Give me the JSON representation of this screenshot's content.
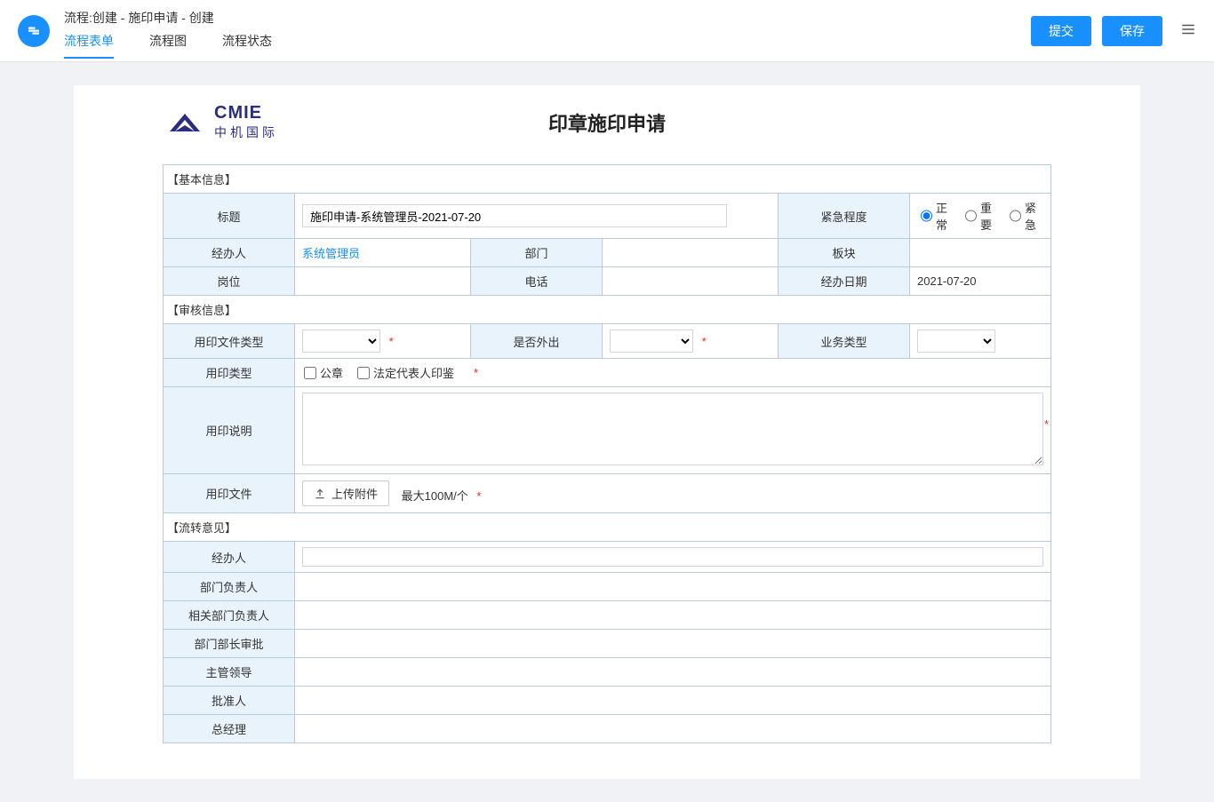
{
  "header": {
    "breadcrumb": "流程:创建 - 施印申请 - 创建",
    "tabs": {
      "form": "流程表单",
      "diagram": "流程图",
      "status": "流程状态"
    },
    "actions": {
      "submit": "提交",
      "save": "保存"
    }
  },
  "logo": {
    "en": "CMIE",
    "cn": "中机国际"
  },
  "form_title": "印章施印申请",
  "sections": {
    "basic": "【基本信息】",
    "audit": "【审核信息】",
    "flow": "【流转意见】"
  },
  "labels": {
    "title": "标题",
    "urgency": "紧急程度",
    "handler": "经办人",
    "department": "部门",
    "block": "板块",
    "position": "岗位",
    "phone": "电话",
    "handle_date": "经办日期",
    "file_type": "用印文件类型",
    "is_out": "是否外出",
    "biz_type": "业务类型",
    "seal_type": "用印类型",
    "seal_desc": "用印说明",
    "seal_file": "用印文件",
    "op_handler": "经办人",
    "op_dept_head": "部门负责人",
    "op_rel_dept_head": "相关部门负责人",
    "op_dept_chief": "部门部长审批",
    "op_leader": "主管领导",
    "op_approver": "批准人",
    "op_gm": "总经理"
  },
  "values": {
    "title_value": "施印申请-系统管理员-2021-07-20",
    "handler_name": "系统管理员",
    "handle_date": "2021-07-20"
  },
  "options": {
    "urgency_normal": "正常",
    "urgency_important": "重要",
    "urgency_urgent": "紧急",
    "seal_official": "公章",
    "seal_legal": "法定代表人印鉴"
  },
  "upload": {
    "button": "上传附件",
    "hint": "最大100M/个"
  }
}
